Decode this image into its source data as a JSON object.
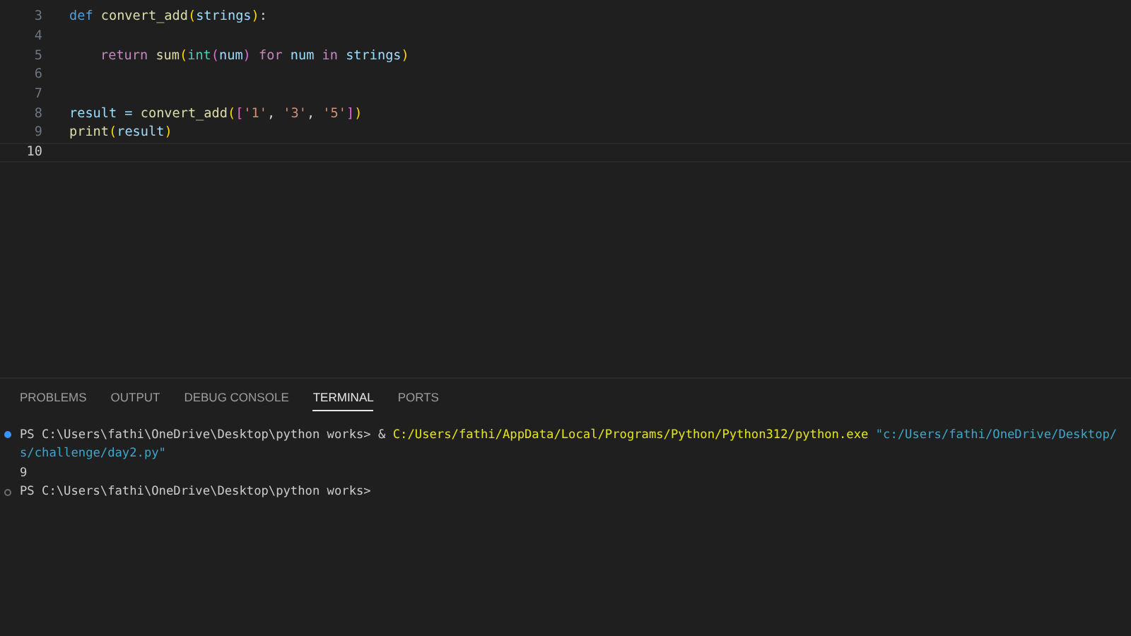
{
  "editor": {
    "lines": [
      {
        "number": "3",
        "current": false,
        "indented": false,
        "tokens": [
          {
            "text": "def ",
            "kind": "keyword"
          },
          {
            "text": "convert_add",
            "kind": "function"
          },
          {
            "text": "(",
            "kind": "bracket1"
          },
          {
            "text": "strings",
            "kind": "param"
          },
          {
            "text": ")",
            "kind": "bracket1"
          },
          {
            "text": ":",
            "kind": "plain"
          }
        ]
      },
      {
        "number": "4",
        "current": false
      },
      {
        "number": "5",
        "current": false,
        "indented": true,
        "tokens": [
          {
            "text": "return ",
            "kind": "control"
          },
          {
            "text": "sum",
            "kind": "function"
          },
          {
            "text": "(",
            "kind": "bracket1"
          },
          {
            "text": "int",
            "kind": "type"
          },
          {
            "text": "(",
            "kind": "bracket2"
          },
          {
            "text": "num",
            "kind": "param"
          },
          {
            "text": ") ",
            "kind": "bracket2"
          },
          {
            "text": "for ",
            "kind": "control"
          },
          {
            "text": "num ",
            "kind": "param"
          },
          {
            "text": "in ",
            "kind": "control"
          },
          {
            "text": "strings",
            "kind": "param"
          },
          {
            "text": ")",
            "kind": "bracket1"
          }
        ]
      },
      {
        "number": "6",
        "current": false
      },
      {
        "number": "7",
        "current": false
      },
      {
        "number": "8",
        "current": false,
        "indented": false,
        "tokens": [
          {
            "text": "result = ",
            "kind": "param"
          },
          {
            "text": "convert_add",
            "kind": "function"
          },
          {
            "text": "(",
            "kind": "bracket1"
          },
          {
            "text": "[",
            "kind": "bracket2"
          },
          {
            "text": "'1'",
            "kind": "string"
          },
          {
            "text": ", ",
            "kind": "plain"
          },
          {
            "text": "'3'",
            "kind": "string"
          },
          {
            "text": ", ",
            "kind": "plain"
          },
          {
            "text": "'5'",
            "kind": "string"
          },
          {
            "text": "]",
            "kind": "bracket2"
          },
          {
            "text": ")",
            "kind": "bracket1"
          }
        ]
      },
      {
        "number": "9",
        "current": false,
        "indented": false,
        "tokens": [
          {
            "text": "print",
            "kind": "function"
          },
          {
            "text": "(",
            "kind": "bracket1"
          },
          {
            "text": "result",
            "kind": "param"
          },
          {
            "text": ")",
            "kind": "bracket1"
          }
        ]
      },
      {
        "number": "10",
        "current": true
      }
    ]
  },
  "panel": {
    "tabs": [
      {
        "label": "PROBLEMS",
        "selected": false
      },
      {
        "label": "OUTPUT",
        "selected": false
      },
      {
        "label": "DEBUG CONSOLE",
        "selected": false
      },
      {
        "label": "TERMINAL",
        "selected": true
      },
      {
        "label": "PORTS",
        "selected": false
      }
    ],
    "terminal": [
      {
        "marked": true,
        "success": true,
        "segments": [
          {
            "text": "PS C:\\Users\\fathi\\OneDrive\\Desktop\\python works> & ",
            "kind": "plain"
          },
          {
            "text": "C:/Users/fathi/AppData/Local/Programs/Python/Python312/python.exe ",
            "kind": "command"
          },
          {
            "text": "\"c:/Users/fathi/OneDrive/Desktop/",
            "kind": "string"
          }
        ]
      },
      {
        "marked": false,
        "segments": [
          {
            "text": "s/challenge/day2.py\"",
            "kind": "string"
          }
        ]
      },
      {
        "marked": false,
        "segments": [
          {
            "text": "9",
            "kind": "plain"
          }
        ]
      },
      {
        "marked": true,
        "success": false,
        "segments": [
          {
            "text": "PS C:\\Users\\fathi\\OneDrive\\Desktop\\python works>",
            "kind": "plain"
          }
        ]
      }
    ]
  }
}
